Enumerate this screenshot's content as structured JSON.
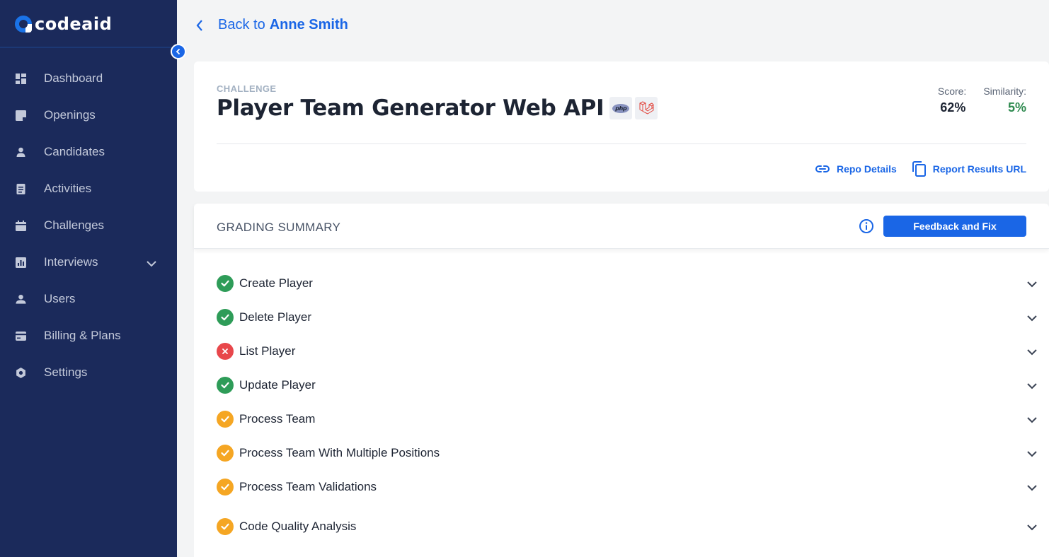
{
  "app": {
    "logo_text": "codeaid"
  },
  "sidebar": {
    "items": [
      {
        "label": "Dashboard",
        "icon": "dashboard-icon"
      },
      {
        "label": "Openings",
        "icon": "note-icon"
      },
      {
        "label": "Candidates",
        "icon": "person-icon"
      },
      {
        "label": "Activities",
        "icon": "document-icon"
      },
      {
        "label": "Challenges",
        "icon": "calendar-icon"
      },
      {
        "label": "Interviews",
        "icon": "chart-icon",
        "has_submenu": true
      },
      {
        "label": "Users",
        "icon": "users-icon"
      },
      {
        "label": "Billing & Plans",
        "icon": "card-icon"
      },
      {
        "label": "Settings",
        "icon": "gear-icon"
      }
    ]
  },
  "back": {
    "prefix": "Back to",
    "name": "Anne Smith"
  },
  "challenge": {
    "kicker": "CHALLENGE",
    "title": "Player Team Generator Web API",
    "techs": [
      "php",
      "laravel"
    ]
  },
  "stats": {
    "score_label": "Score:",
    "score_value": "62%",
    "similarity_label": "Similarity:",
    "similarity_value": "5%"
  },
  "links": {
    "repo_details": "Repo Details",
    "report_url": "Report Results URL"
  },
  "summary": {
    "title": "GRADING SUMMARY",
    "fix_button": "Feedback and Fix",
    "items": [
      {
        "label": "Create Player",
        "status": "pass"
      },
      {
        "label": "Delete Player",
        "status": "pass"
      },
      {
        "label": "List Player",
        "status": "fail"
      },
      {
        "label": "Update Player",
        "status": "pass"
      },
      {
        "label": "Process Team",
        "status": "partial"
      },
      {
        "label": "Process Team With Multiple Positions",
        "status": "partial"
      },
      {
        "label": "Process Team Validations",
        "status": "partial"
      },
      {
        "label": "Code Quality Analysis",
        "status": "partial"
      }
    ]
  },
  "colors": {
    "sidebar_bg": "#1b2a5b",
    "accent": "#1a66e6",
    "pass": "#2e9c58",
    "fail": "#e8474b",
    "partial": "#f5a623",
    "similarity": "#2e8a4f"
  }
}
